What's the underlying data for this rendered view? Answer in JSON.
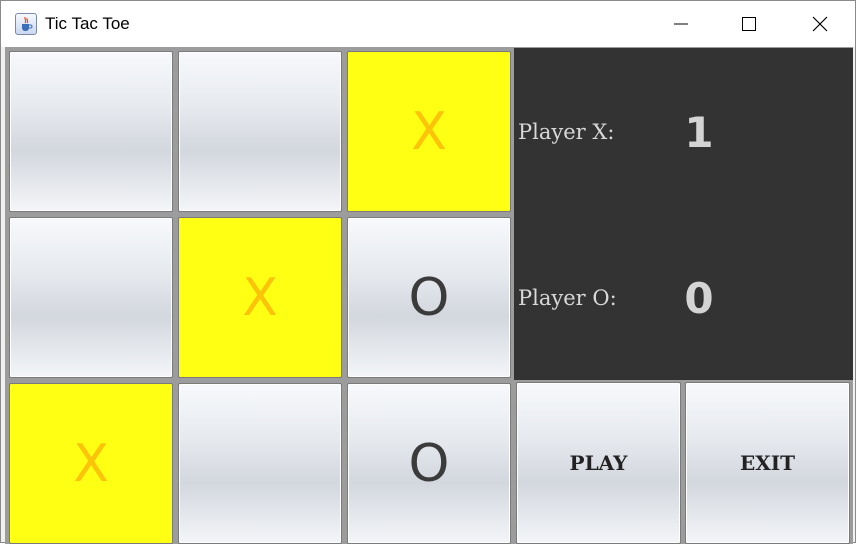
{
  "window": {
    "title": "Tic Tac Toe",
    "icon": "java-cup-icon",
    "controls": [
      "minimize-icon",
      "maximize-icon",
      "close-icon"
    ]
  },
  "board": {
    "cells": [
      {
        "mark": "",
        "highlighted": false
      },
      {
        "mark": "",
        "highlighted": false
      },
      {
        "mark": "X",
        "highlighted": true
      },
      {
        "mark": "",
        "highlighted": false
      },
      {
        "mark": "X",
        "highlighted": true
      },
      {
        "mark": "O",
        "highlighted": false
      },
      {
        "mark": "X",
        "highlighted": true
      },
      {
        "mark": "",
        "highlighted": false
      },
      {
        "mark": "O",
        "highlighted": false
      }
    ],
    "highlight_color": "#ffff14",
    "highlight_mark_color": "#fbc30a",
    "mark_color": "#3b3b3b"
  },
  "scores": {
    "player_x_label": "Player X:",
    "player_x_value": "1",
    "player_o_label": "Player O:",
    "player_o_value": "0",
    "panel_color": "#333333"
  },
  "actions": {
    "play_label": "PLAY",
    "exit_label": "EXIT"
  }
}
